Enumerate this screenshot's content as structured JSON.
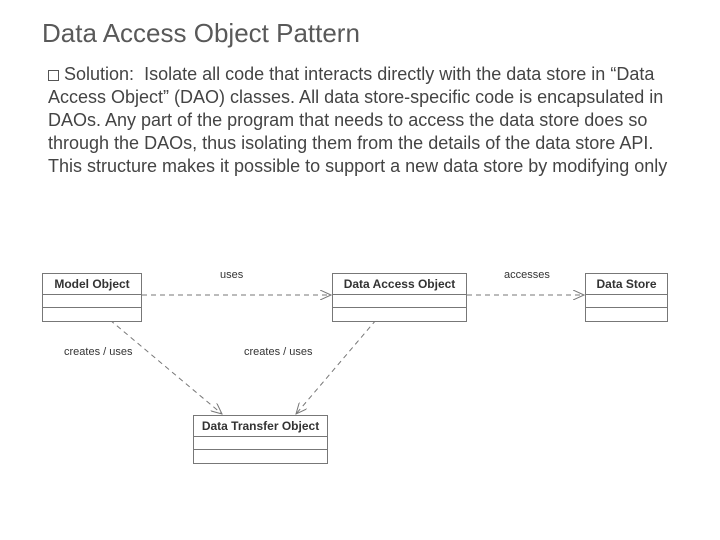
{
  "title": "Data Access Object Pattern",
  "bullet_label": "Solution:",
  "body_text": "Isolate all code that interacts directly with the data store in “Data Access Object” (DAO) classes.  All data store-specific code is encapsulated in DAOs.  Any part of the program that needs to access the data store does so through the DAOs, thus isolating them from the details of the data store API.  This structure makes it possible to support a new data store by modifying only",
  "diagram": {
    "boxes": {
      "model_object": "Model Object",
      "dao": "Data Access Object",
      "data_store": "Data Store",
      "dto": "Data Transfer Object"
    },
    "edges": {
      "uses1": "uses",
      "accesses": "accesses",
      "creates_uses_left": "creates / uses",
      "creates_uses_right": "creates / uses"
    }
  }
}
